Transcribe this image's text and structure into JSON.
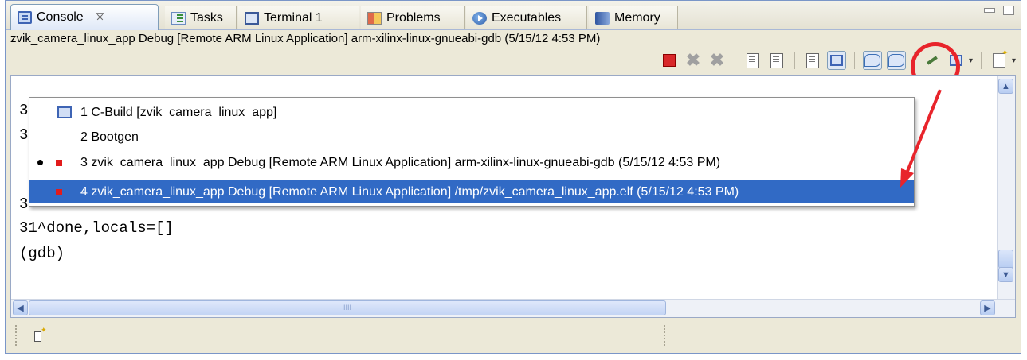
{
  "tabs": [
    {
      "label": "Console",
      "icon": "console-icon",
      "active": true
    },
    {
      "label": "Tasks",
      "icon": "tasks-icon"
    },
    {
      "label": "Terminal 1",
      "icon": "terminal-icon"
    },
    {
      "label": "Problems",
      "icon": "problems-icon"
    },
    {
      "label": "Executables",
      "icon": "executables-icon"
    },
    {
      "label": "Memory",
      "icon": "memory-icon"
    }
  ],
  "tab_close_glyph": "☒",
  "console_title": "zvik_camera_linux_app Debug [Remote ARM Linux Application] arm-xilinx-linux-gnueabi-gdb (5/15/12 4:53 PM)",
  "console_lines": [
    "31^done,locals=[]",
    "(gdb)"
  ],
  "hidden_line_prefixes": [
    "3",
    "3",
    "3"
  ],
  "toolbar_icons": [
    "terminate-icon",
    "remove-launch-icon",
    "remove-all-terminated-icon",
    "clear-console-icon",
    "scroll-lock-icon",
    "word-wrap-icon",
    "show-console-on-output-icon",
    "show-on-stdout-icon",
    "show-on-stderr-icon",
    "pin-console-icon",
    "display-selected-console-icon",
    "open-console-icon"
  ],
  "menu": {
    "items": [
      {
        "label": "1 C-Build [zvik_camera_linux_app]",
        "icon": "console-icon"
      },
      {
        "label": "2 Bootgen"
      },
      {
        "label": "3 zvik_camera_linux_app Debug [Remote ARM Linux Application] arm-xilinx-linux-gnueabi-gdb (5/15/12 4:53 PM)",
        "checked": true,
        "running": true
      },
      {
        "label": "4 zvik_camera_linux_app Debug [Remote ARM Linux Application] /tmp/zvik_camera_linux_app.elf (5/15/12 4:53 PM)",
        "running": true,
        "selected": true
      }
    ]
  },
  "colors": {
    "selection": "#316ac5",
    "annotation": "#e8242b",
    "running": "#e21b1b"
  }
}
